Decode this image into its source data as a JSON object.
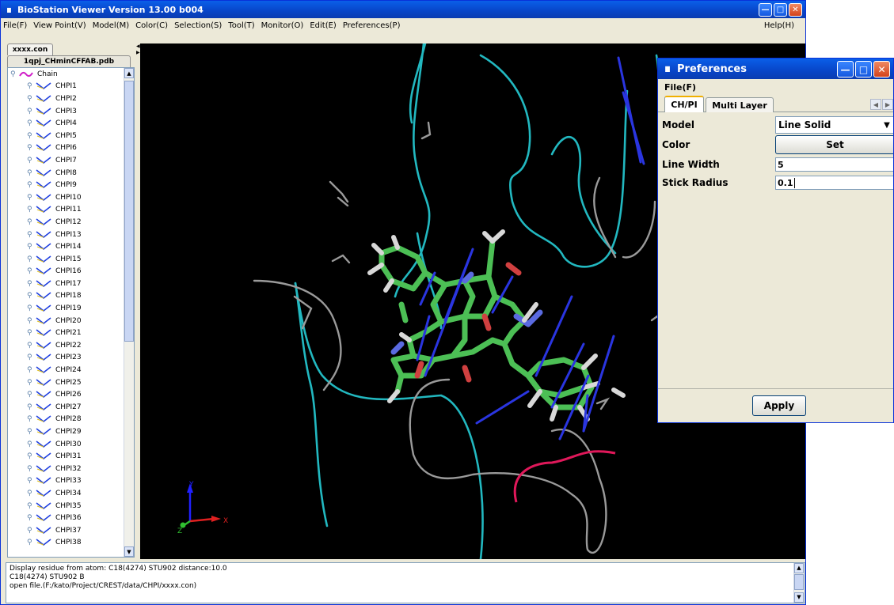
{
  "window": {
    "title": "BioStation Viewer Version 13.00 b004",
    "app_icon": "molecule-icon"
  },
  "menubar": {
    "items": [
      "File(F)",
      "View Point(V)",
      "Model(M)",
      "Color(C)",
      "Selection(S)",
      "Tool(T)",
      "Monitor(O)",
      "Edit(E)",
      "Preferences(P)"
    ],
    "help": "Help(H)"
  },
  "left_panel": {
    "tabs": [
      "xxxx.con",
      "1qpj_CHminCFFAB.pdb"
    ],
    "tree_root": "Chain",
    "tree_items": [
      "CHPI1",
      "CHPI2",
      "CHPI3",
      "CHPI4",
      "CHPI5",
      "CHPI6",
      "CHPI7",
      "CHPI8",
      "CHPI9",
      "CHPI10",
      "CHPI11",
      "CHPI12",
      "CHPI13",
      "CHPI14",
      "CHPI15",
      "CHPI16",
      "CHPI17",
      "CHPI18",
      "CHPI19",
      "CHPI20",
      "CHPI21",
      "CHPI22",
      "CHPI23",
      "CHPI24",
      "CHPI25",
      "CHPI26",
      "CHPI27",
      "CHPI28",
      "CHPI29",
      "CHPI30",
      "CHPI31",
      "CHPI32",
      "CHPI33",
      "CHPI34",
      "CHPI35",
      "CHPI36",
      "CHPI37",
      "CHPI38"
    ]
  },
  "viewer": {
    "axis_labels": {
      "x": "X",
      "y": "Y",
      "z": "Z"
    },
    "colors": {
      "background": "#000000",
      "backbone_cyan": "#22b8c0",
      "backbone_gray": "#9a9a9a",
      "chpi_line": "#2a35e0",
      "ligand_carbon": "#4cbf55",
      "ligand_nitrogen": "#5a6ae0",
      "ligand_oxygen": "#d04040",
      "ligand_hydrogen": "#d8d8d8",
      "highlight": "#e0185a"
    }
  },
  "console": {
    "lines": [
      "Display residue from atom: C18(4274) STU902  distance:10.0",
      "C18(4274) STU902 B",
      "open file.(F:/kato/Project/CREST/data/CHPI/xxxx.con)"
    ]
  },
  "preferences": {
    "title": "Preferences",
    "menu": "File(F)",
    "tabs": [
      "CH/PI",
      "Multi Layer"
    ],
    "rows": {
      "model_label": "Model",
      "model_value": "Line Solid",
      "color_label": "Color",
      "color_button": "Set",
      "line_width_label": "Line Width",
      "line_width_value": "5",
      "stick_radius_label": "Stick Radius",
      "stick_radius_value": "0.1"
    },
    "apply": "Apply"
  }
}
